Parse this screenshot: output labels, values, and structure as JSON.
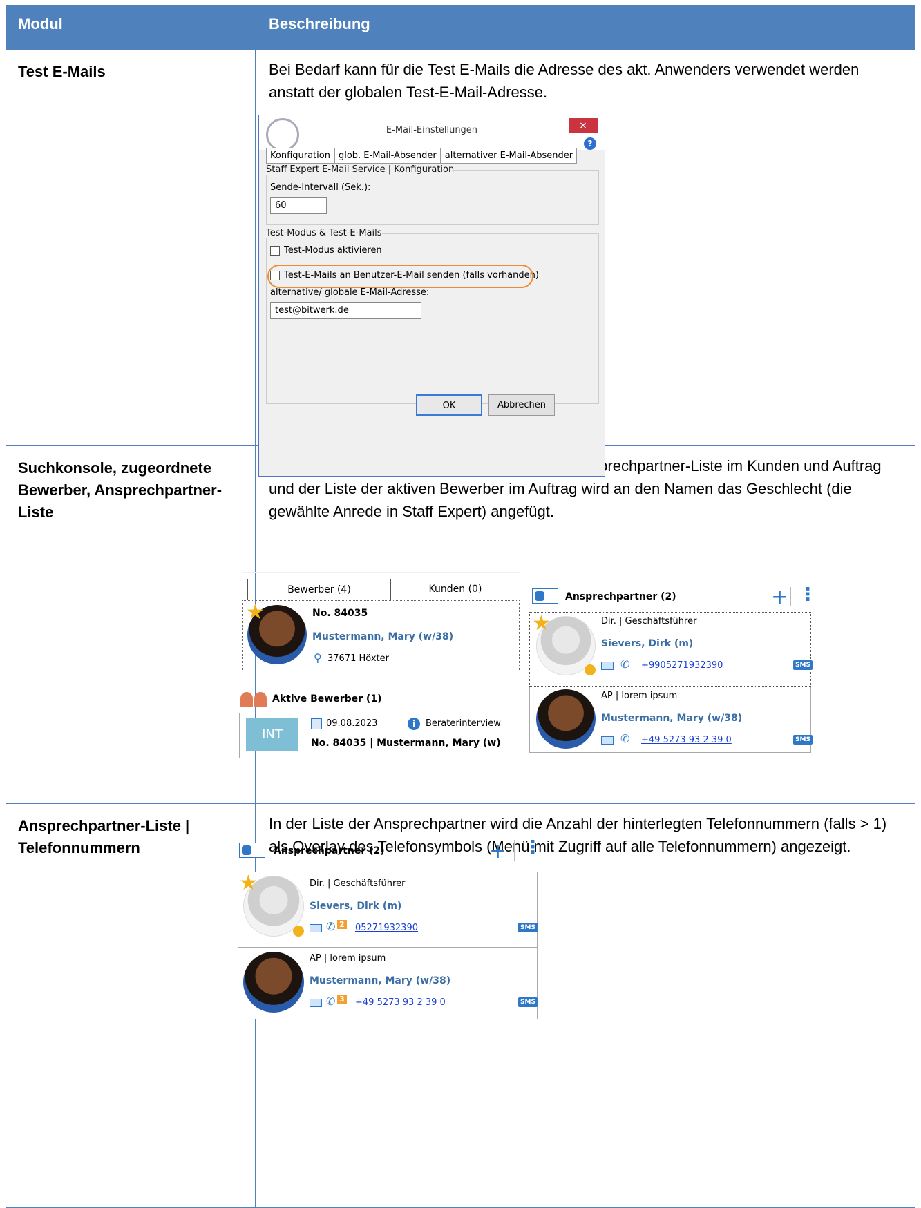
{
  "header": {
    "col1": "Modul",
    "col2": "Beschreibung"
  },
  "rows": [
    {
      "module": "Test E-Mails",
      "description": "Bei Bedarf kann für die Test E-Mails die Adresse des akt. Anwenders verwendet werden anstatt der globalen Test-E-Mail-Adresse.",
      "dialog": {
        "title": "E-Mail-Einstellungen",
        "close": "×",
        "help": "?",
        "tabs": [
          "Konfiguration",
          "glob. E-Mail-Absender",
          "alternativer E-Mail-Absender"
        ],
        "group1_label": "Staff Expert E-Mail Service | Konfiguration",
        "interval_label": "Sende-Intervall (Sek.):",
        "interval_value": "60",
        "group2_label": "Test-Modus & Test-E-Mails",
        "checkbox1": "Test-Modus aktivieren",
        "checkbox2": "Test-E-Mails an Benutzer-E-Mail senden (falls vorhanden)",
        "address_label": "alternative/ globale E-Mail-Adresse:",
        "address_value": "test@bitwerk.de",
        "ok": "OK",
        "cancel": "Abbrechen"
      }
    },
    {
      "module": "Suchkonsole, zugeordnete Bewerber, Ansprechpartner-Liste",
      "description": "Im Suchergebnis der Suchkonsole sowie der Ansprechpartner-Liste im Kunden und Auftrag und der Liste der aktiven Bewerber im Auftrag wird an den Namen das Geschlecht (die gewählte Anrede in Staff Expert) angefügt.",
      "search": {
        "tab1": "Bewerber (4)",
        "tab2": "Kunden (0)",
        "number": "No. 84035",
        "name": "Mustermann, Mary (w/38)",
        "location": "37671 Höxter"
      },
      "active": {
        "title": "Aktive Bewerber (1)",
        "tag": "INT",
        "date": "09.08.2023",
        "type": "Beraterinterview",
        "line": "No. 84035 | Mustermann, Mary (w)"
      },
      "contacts": {
        "title": "Ansprechpartner (2)",
        "plus": "+",
        "items": [
          {
            "role": "Dir. | Geschäftsführer",
            "name": "Sievers, Dirk (m)",
            "phone": "+9905271932390"
          },
          {
            "role": "AP | lorem ipsum",
            "name": "Mustermann, Mary (w/38)",
            "phone": "+49 5273 93 2 39 0"
          }
        ],
        "sms": "SMS"
      }
    },
    {
      "module": "Ansprechpartner-Liste | Telefonnummern",
      "description": "In der Liste der Ansprechpartner wird die Anzahl der hinterlegten Telefonnummern (falls > 1) als Overlay des Telefonsymbols (Menü mit Zugriff auf alle Telefonnummern) angezeigt.",
      "contacts": {
        "title": "Ansprechpartner (2)",
        "plus": "+",
        "items": [
          {
            "role": "Dir. | Geschäftsführer",
            "name": "Sievers, Dirk (m)",
            "phone": "05271932390",
            "count": "2"
          },
          {
            "role": "AP | lorem ipsum",
            "name": "Mustermann, Mary (w/38)",
            "phone": "+49 5273 93 2 39 0",
            "count": "3"
          }
        ],
        "sms": "SMS"
      }
    }
  ]
}
